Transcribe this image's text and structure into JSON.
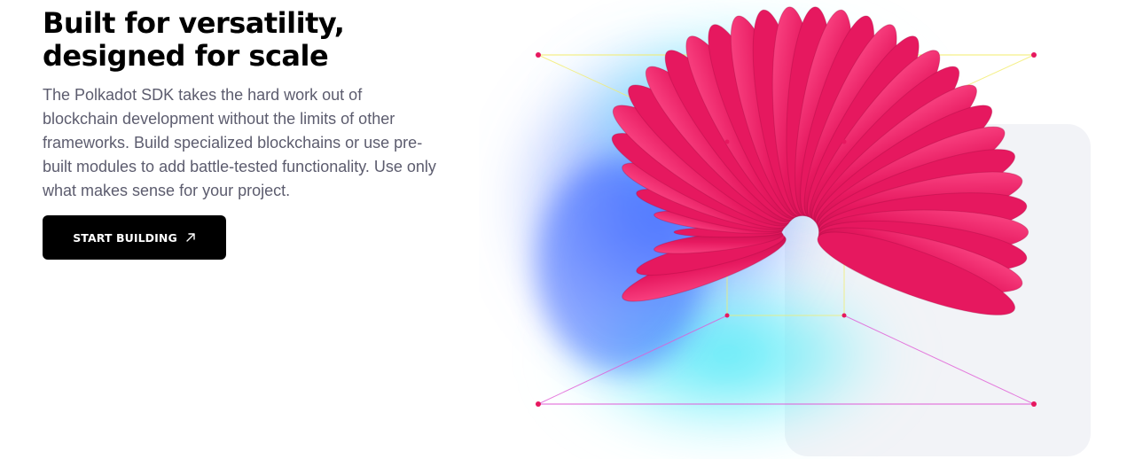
{
  "section": {
    "headline_line1": "Built for versatility,",
    "headline_line2": "designed for scale",
    "description": "The Polkadot SDK takes the hard work out of blockchain development without the limits of other frameworks. Build specialized blockchains or use pre-built modules to add battle-tested functionality. Use only what makes sense for your project.",
    "cta_label": "START BUILDING",
    "cta_icon": "arrow-up-right-icon"
  },
  "illustration": {
    "name": "pink-spiral-illustration",
    "colors": {
      "accent_pink": "#e6185f",
      "glow_cyan": "#3fe6f5",
      "glow_blue": "#3f6bff",
      "frame_yellow": "#f3ec6b",
      "frame_magenta": "#e05bd6"
    }
  }
}
